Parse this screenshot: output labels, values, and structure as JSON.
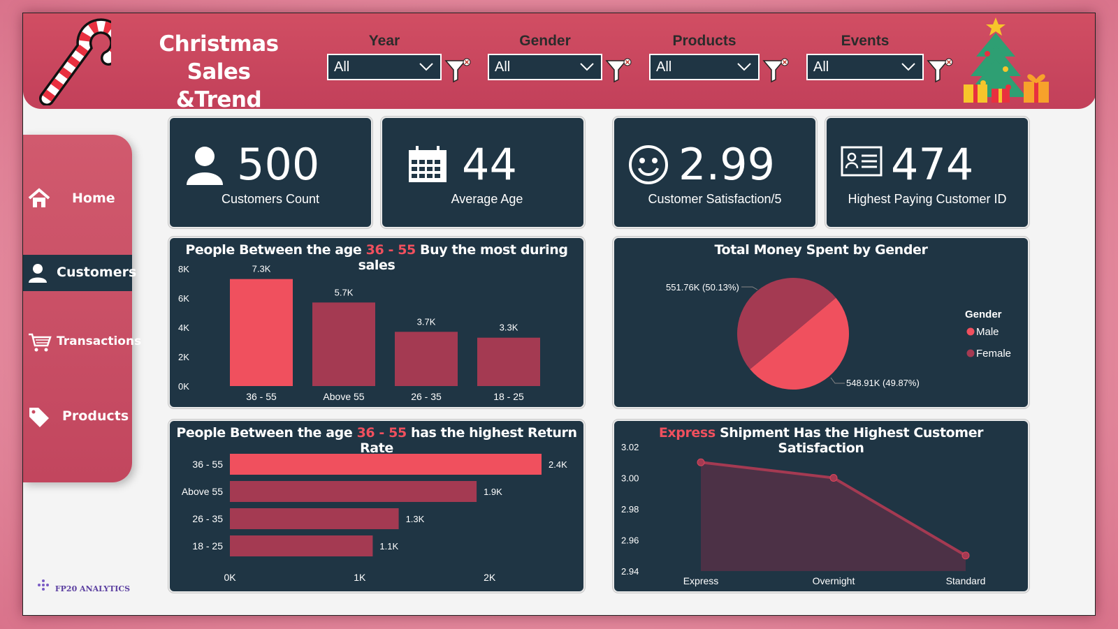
{
  "header": {
    "title_line1": "Christmas Sales",
    "title_line2": "&Trend Analysis"
  },
  "slicers": [
    {
      "label": "Year",
      "value": "All"
    },
    {
      "label": "Gender",
      "value": "All"
    },
    {
      "label": "Products",
      "value": "All"
    },
    {
      "label": "Events",
      "value": "All"
    }
  ],
  "nav": {
    "items": [
      {
        "label": "Home",
        "icon": "home-icon"
      },
      {
        "label": "Customers",
        "icon": "user-icon",
        "active": true
      },
      {
        "label": "Transactions",
        "icon": "cart-icon"
      },
      {
        "label": "Products",
        "icon": "tag-icon"
      }
    ]
  },
  "brand": "FP20 ANALYTICS",
  "kpis": [
    {
      "value": "500",
      "label": "Customers Count",
      "icon": "user-icon"
    },
    {
      "value": "44",
      "label": "Average Age",
      "icon": "calendar-icon"
    },
    {
      "value": "2.99",
      "label": "Customer Satisfaction/5",
      "icon": "smiley-icon"
    },
    {
      "value": "474",
      "label": "Highest Paying Customer ID",
      "icon": "id-card-icon"
    }
  ],
  "colors": {
    "accent": "#f0505e",
    "secondary": "#a43a52",
    "panel": "#1f3544",
    "header": "#c94a60"
  },
  "chart_titles": {
    "age_sales": {
      "pre": "People Between the age ",
      "hl": "36 - 55",
      "post": " Buy the most during sales"
    },
    "gender": {
      "text": "Total Money Spent by Gender"
    },
    "return_rate": {
      "pre": "People Between the age ",
      "hl": "36 - 55",
      "post": " has the highest Return Rate"
    },
    "shipment": {
      "hl": "Express",
      "post": " Shipment Has the Highest Customer Satisfaction"
    }
  },
  "chart_data": [
    {
      "type": "bar",
      "categories": [
        "36 - 55",
        "Above 55",
        "26 - 35",
        "18 - 25"
      ],
      "values": [
        7300,
        5700,
        3700,
        3300
      ],
      "data_labels": [
        "7.3K",
        "5.7K",
        "3.7K",
        "3.3K"
      ],
      "y_ticks": [
        "0K",
        "2K",
        "4K",
        "6K",
        "8K"
      ],
      "ylim": [
        0,
        8000
      ],
      "title": "People Between the age 36 - 55 Buy the most during sales"
    },
    {
      "type": "pie",
      "title": "Total Money Spent by Gender",
      "legend_title": "Gender",
      "legend_position": "right",
      "slices": [
        {
          "name": "Male",
          "value": 551.76,
          "label": "551.76K (50.13%)",
          "color": "#f0505e"
        },
        {
          "name": "Female",
          "value": 548.91,
          "label": "548.91K (49.87%)",
          "color": "#a43a52"
        }
      ]
    },
    {
      "type": "bar",
      "orientation": "horizontal",
      "categories": [
        "36 - 55",
        "Above 55",
        "26 - 35",
        "18 - 25"
      ],
      "values": [
        2400,
        1900,
        1300,
        1100
      ],
      "data_labels": [
        "2.4K",
        "1.9K",
        "1.3K",
        "1.1K"
      ],
      "x_ticks": [
        "0K",
        "1K",
        "2K"
      ],
      "xlim": [
        0,
        2400
      ],
      "title": "People Between the age 36 - 55 has the highest Return Rate"
    },
    {
      "type": "area",
      "categories": [
        "Express",
        "Overnight",
        "Standard"
      ],
      "values": [
        3.01,
        3.0,
        2.95
      ],
      "y_ticks": [
        "2.94",
        "2.96",
        "2.98",
        "3.00",
        "3.02"
      ],
      "ylim": [
        2.94,
        3.02
      ],
      "title": "Express Shipment Has the Highest Customer Satisfaction"
    }
  ]
}
